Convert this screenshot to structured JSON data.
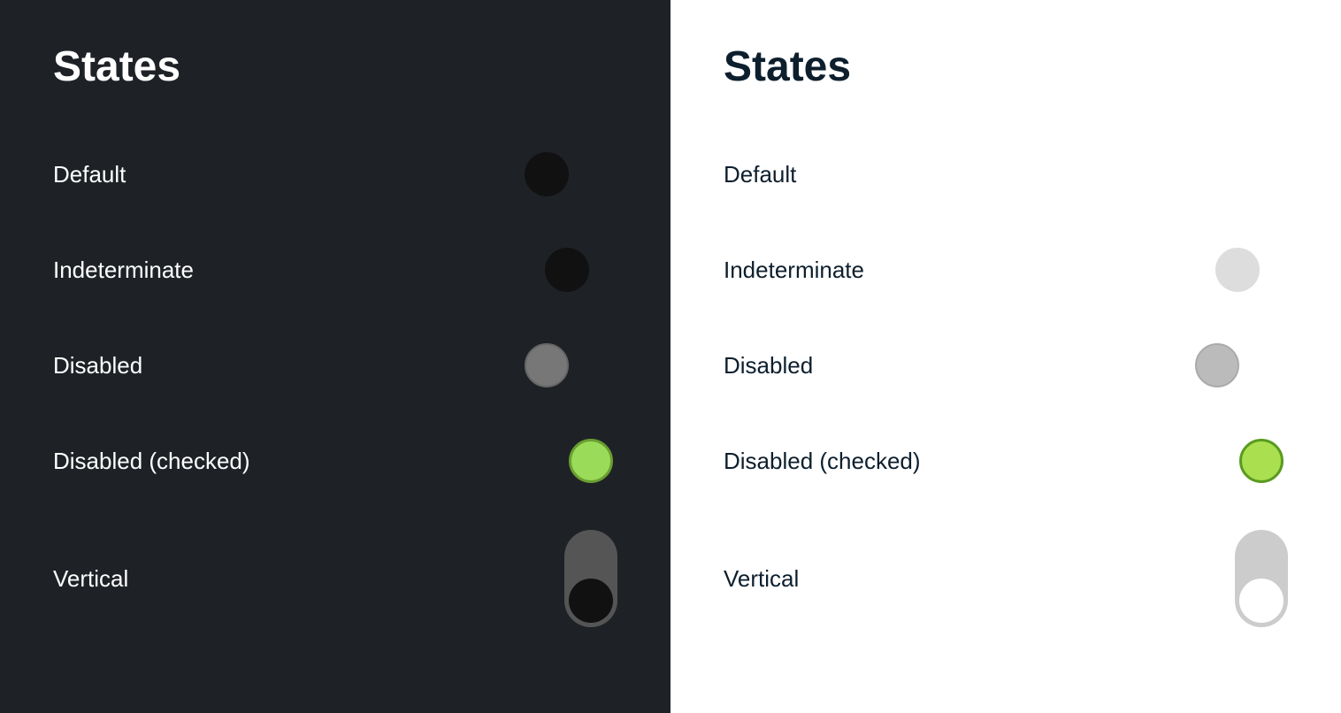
{
  "dark_panel": {
    "title": "States",
    "states": [
      {
        "label": "Default",
        "key": "default"
      },
      {
        "label": "Indeterminate",
        "key": "indeterminate"
      },
      {
        "label": "Disabled",
        "key": "disabled"
      },
      {
        "label": "Disabled (checked)",
        "key": "disabled-checked"
      },
      {
        "label": "Vertical",
        "key": "vertical"
      }
    ]
  },
  "light_panel": {
    "title": "States",
    "states": [
      {
        "label": "Default",
        "key": "default"
      },
      {
        "label": "Indeterminate",
        "key": "indeterminate"
      },
      {
        "label": "Disabled",
        "key": "disabled"
      },
      {
        "label": "Disabled (checked)",
        "key": "disabled-checked"
      },
      {
        "label": "Vertical",
        "key": "vertical"
      }
    ]
  }
}
